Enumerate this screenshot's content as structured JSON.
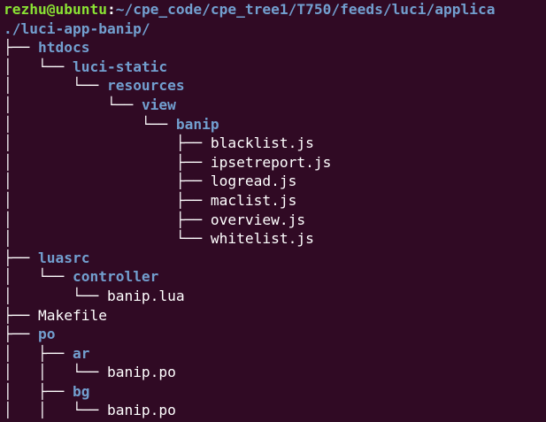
{
  "prompt": {
    "user_host": "rezhu@ubuntu",
    "separator": ":",
    "path": "~/cpe_code/cpe_tree1/T750/feeds/luci/applica"
  },
  "root": "./luci-app-banip/",
  "lines": [
    {
      "prefix": "├── ",
      "name": "htdocs",
      "kind": "dir"
    },
    {
      "prefix": "│   └── ",
      "name": "luci-static",
      "kind": "dir"
    },
    {
      "prefix": "│       └── ",
      "name": "resources",
      "kind": "dir"
    },
    {
      "prefix": "│           └── ",
      "name": "view",
      "kind": "dir"
    },
    {
      "prefix": "│               └── ",
      "name": "banip",
      "kind": "dir"
    },
    {
      "prefix": "│                   ├── ",
      "name": "blacklist.js",
      "kind": "file"
    },
    {
      "prefix": "│                   ├── ",
      "name": "ipsetreport.js",
      "kind": "file"
    },
    {
      "prefix": "│                   ├── ",
      "name": "logread.js",
      "kind": "file"
    },
    {
      "prefix": "│                   ├── ",
      "name": "maclist.js",
      "kind": "file"
    },
    {
      "prefix": "│                   ├── ",
      "name": "overview.js",
      "kind": "file"
    },
    {
      "prefix": "│                   └── ",
      "name": "whitelist.js",
      "kind": "file"
    },
    {
      "prefix": "├── ",
      "name": "luasrc",
      "kind": "dir"
    },
    {
      "prefix": "│   └── ",
      "name": "controller",
      "kind": "dir"
    },
    {
      "prefix": "│       └── ",
      "name": "banip.lua",
      "kind": "file"
    },
    {
      "prefix": "├── ",
      "name": "Makefile",
      "kind": "file"
    },
    {
      "prefix": "├── ",
      "name": "po",
      "kind": "dir"
    },
    {
      "prefix": "│   ├── ",
      "name": "ar",
      "kind": "dir"
    },
    {
      "prefix": "│   │   └── ",
      "name": "banip.po",
      "kind": "file"
    },
    {
      "prefix": "│   ├── ",
      "name": "bg",
      "kind": "dir"
    },
    {
      "prefix": "│   │   └── ",
      "name": "banip.po",
      "kind": "file"
    }
  ],
  "colors": {
    "background": "#300a24",
    "prompt_user": "#8ae234",
    "directory": "#729fcf",
    "text": "#ffffff"
  }
}
